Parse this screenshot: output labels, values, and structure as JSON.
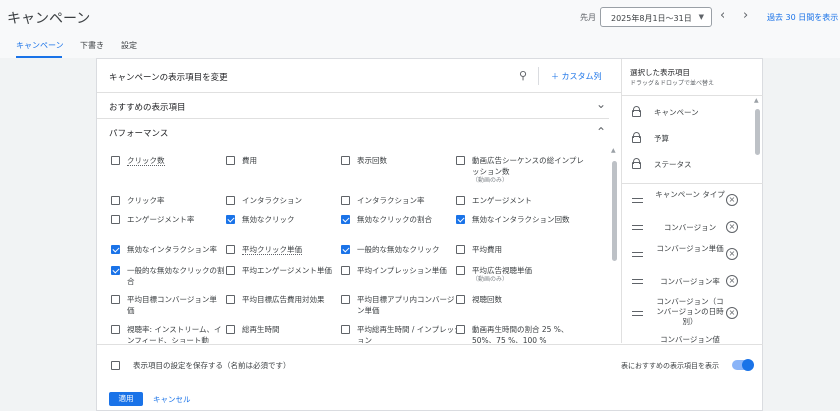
{
  "header": {
    "title": "キャンペーン",
    "prev_label": "先月",
    "date_range": "2025年8月1日〜31日",
    "last30_label": "過去 30 日間を表示"
  },
  "tabs": [
    {
      "label": "キャンペーン",
      "active": true
    },
    {
      "label": "下書き",
      "active": false
    },
    {
      "label": "設定",
      "active": false
    }
  ],
  "panel": {
    "title": "キャンペーンの表示項目を変更",
    "custom_label": "カスタム列",
    "sections": [
      {
        "label": "おすすめの表示項目",
        "expanded": false
      },
      {
        "label": "パフォーマンス",
        "expanded": true
      }
    ],
    "items": [
      {
        "label": "クリック数",
        "checked": false
      },
      {
        "label": "費用",
        "checked": false
      },
      {
        "label": "表示回数",
        "checked": false
      },
      {
        "label": "動画広告シーケンスの総インプレッション数",
        "sub": "（動画のみ）",
        "checked": false
      },
      {
        "label": "クリック率",
        "checked": false
      },
      {
        "label": "インタラクション",
        "checked": false
      },
      {
        "label": "インタラクション率",
        "checked": false
      },
      {
        "label": "エンゲージメント",
        "checked": false
      },
      {
        "label": "エンゲージメント率",
        "checked": false
      },
      {
        "label": "無効なクリック",
        "checked": true
      },
      {
        "label": "無効なクリックの割合",
        "checked": true
      },
      {
        "label": "無効なインタラクション回数",
        "checked": true
      },
      {
        "label": "無効なインタラクション率",
        "checked": true
      },
      {
        "label": "平均クリック単価",
        "checked": false
      },
      {
        "label": "一般的な無効なクリック",
        "checked": true
      },
      {
        "label": "平均費用",
        "checked": false
      },
      {
        "label": "一般的な無効なクリックの割合",
        "checked": true
      },
      {
        "label": "平均エンゲージメント単価",
        "checked": false
      },
      {
        "label": "平均インプレッション単価",
        "checked": false
      },
      {
        "label": "平均広告視聴単価",
        "sub": "（動画のみ）",
        "checked": false
      },
      {
        "label": "平均目標コンバージョン単価",
        "checked": false
      },
      {
        "label": "平均目標広告費用対効果",
        "checked": false
      },
      {
        "label": "平均目標アプリ内コンバージョン単価",
        "checked": false
      },
      {
        "label": "視聴回数",
        "checked": false
      },
      {
        "label": "視聴率: インストリーム、インフィード、ショート動",
        "checked": false
      },
      {
        "label": "総再生時間",
        "checked": false
      },
      {
        "label": "平均総再生時間 / インプレッション",
        "checked": false
      },
      {
        "label": "動画再生時間の割合 25 %、50%、75 %、100 %",
        "checked": false
      }
    ],
    "save_label": "表示項目の設定を保存する（名前は必須です）",
    "toggle_label": "表におすすめの表示項目を表示",
    "toggle_on": true,
    "apply_label": "適用",
    "cancel_label": "キャンセル"
  },
  "selected": {
    "title": "選択した表示項目",
    "subtitle": "ドラッグ＆ドロップで並べ替え",
    "locked": [
      "キャンペーン",
      "予算",
      "ステータス"
    ],
    "items": [
      "キャンペーン タイプ",
      "コンバージョン",
      "コンバージョン単価",
      "コンバージョン率",
      "コンバージョン（コンバージョンの日時別）",
      "コンバージョン値"
    ]
  },
  "colors": {
    "accent": "#1a73e8",
    "background": "#f1f3f4"
  }
}
